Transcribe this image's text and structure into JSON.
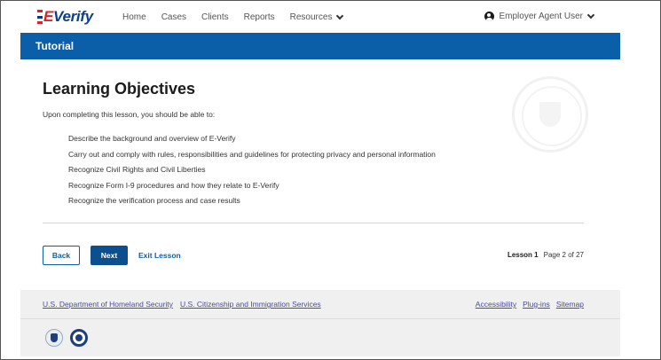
{
  "header": {
    "logo_text_e": "E",
    "logo_text_rest": "Verify",
    "nav": [
      {
        "label": "Home"
      },
      {
        "label": "Cases"
      },
      {
        "label": "Clients"
      },
      {
        "label": "Reports"
      },
      {
        "label": "Resources"
      }
    ],
    "user_label": "Employer Agent User"
  },
  "tutorial_bar": {
    "title": "Tutorial"
  },
  "content": {
    "heading": "Learning Objectives",
    "intro": "Upon completing this lesson, you should be able to:",
    "objectives": [
      "Describe the background and overview of E-Verify",
      "Carry out and comply with rules, responsibilities and guidelines for protecting privacy and personal information",
      "Recognize Civil Rights and Civil Liberties",
      "Recognize Form I-9 procedures and how they relate to E-Verify",
      "Recognize the verification process and case results"
    ]
  },
  "actions": {
    "back_label": "Back",
    "next_label": "Next",
    "exit_label": "Exit Lesson"
  },
  "lesson": {
    "lesson_label": "Lesson 1",
    "page_label": "Page 2 of 27"
  },
  "footer": {
    "left_links": [
      "U.S. Department of Homeland Security",
      "U.S. Citizenship and Immigration Services"
    ],
    "right_links": [
      "Accessibility",
      "Plug-ins",
      "Sitemap"
    ]
  },
  "colors": {
    "brand_blue": "#0b5ea8",
    "logo_red": "#d8232a",
    "link_purple": "#4a4a9a"
  }
}
